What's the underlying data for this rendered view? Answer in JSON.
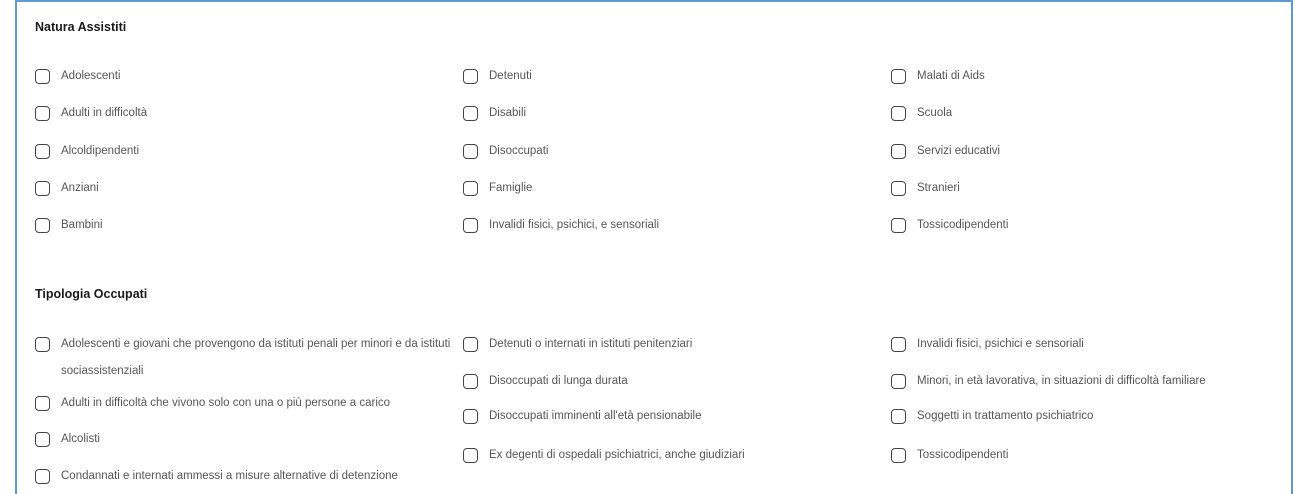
{
  "natura": {
    "title": "Natura Assistiti",
    "items": [
      "Adolescenti",
      "Adulti in difficoltà",
      "Alcoldipendenti",
      "Anziani",
      "Bambini",
      "Detenuti",
      "Disabili",
      "Disoccupati",
      "Famiglie",
      "Invalidi fisici, psichici, e sensoriali",
      "Malati di Aids",
      "Scuola",
      "Servizi educativi",
      "Stranieri",
      "Tossicodipendenti"
    ]
  },
  "tipologia": {
    "title": "Tipologia Occupati",
    "items": [
      "Adolescenti e giovani che provengono da istituti penali per minori e da istituti sociassistenziali",
      "Adulti in difficoltà che vivono solo con una o più persone a carico",
      "Alcolisti",
      "Condannati e internati ammessi a misure alternative di detenzione",
      "Detenuti o internati in istituti penitenziari",
      "Disoccupati di lunga durata",
      "Disoccupati imminenti all'età pensionabile",
      "Ex degenti di ospedali psichiatrici, anche giudiziari",
      "Invalidi fisici, psichici e sensoriali",
      "Minori, in età lavorativa, in situazioni di difficoltà familiare",
      "Soggetti in trattamento psichiatrico",
      "Tossicodipendenti"
    ]
  }
}
